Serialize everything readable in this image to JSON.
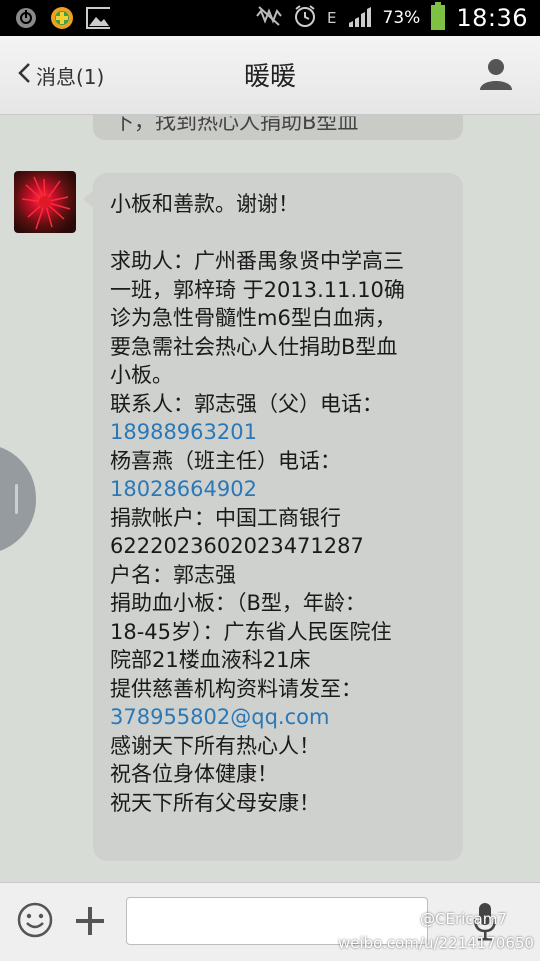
{
  "status_bar": {
    "battery_percent": "73%",
    "time": "18:36",
    "network_letter": "E",
    "icons": [
      "wechat-notify-icon",
      "plus-notify-icon",
      "image-notify-icon",
      "mute-icon",
      "alarm-icon",
      "signal-icon",
      "battery-icon"
    ]
  },
  "header": {
    "back_label": "消息(1)",
    "title": "暖暖"
  },
  "chat": {
    "previous_message_tail": "下，找到热心人捐助B型血",
    "message_lines": [
      "小板和善款。谢谢！",
      "",
      "求助人：广州番禺象贤中学高三",
      "一班，郭梓琦 于2013.11.10确",
      "诊为急性骨髓性m6型白血病，",
      "要急需社会热心人仕捐助B型血",
      "小板。",
      "联系人：郭志强（父）电话：",
      "18988963201",
      "杨喜燕（班主任）电话：",
      "18028664902",
      "捐款帐户：中国工商银行",
      "6222023602023471287",
      "户名：郭志强",
      "捐助血小板：（B型，年龄：",
      "18-45岁）：广东省人民医院住",
      "院部21楼血液科21床",
      "提供慈善机构资料请发至：",
      "378955802@qq.com",
      "感谢天下所有热心人！",
      "祝各位身体健康！",
      "祝天下所有父母安康！"
    ],
    "phone_1": "18988963201",
    "phone_2": "18028664902",
    "email_user": "378955802",
    "email_domain": "@qq.com"
  },
  "watermark": {
    "handle": "@CEricam7",
    "url": "weibo.com/u/2214170650"
  },
  "colors": {
    "link": "#2a78b8",
    "bubble": "#cfd1ce",
    "background": "#d8dcd7"
  }
}
